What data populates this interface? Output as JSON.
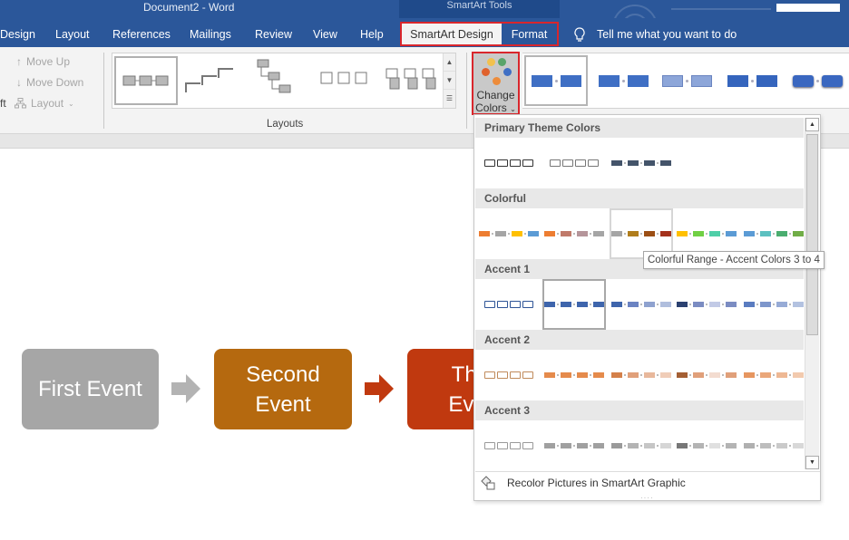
{
  "window": {
    "title": "Document2  -  Word",
    "contextual_group": "SmartArt Tools"
  },
  "tabs": [
    {
      "label": "Design"
    },
    {
      "label": "Layout"
    },
    {
      "label": "References"
    },
    {
      "label": "Mailings"
    },
    {
      "label": "Review"
    },
    {
      "label": "View"
    },
    {
      "label": "Help"
    }
  ],
  "contextual_tabs": {
    "smartart_design": "SmartArt Design",
    "format": "Format"
  },
  "tell_me": {
    "placeholder": "Tell me what you want to do",
    "icon": "lightbulb-icon"
  },
  "ribbon": {
    "create_graphic": {
      "move_up": "Move Up",
      "move_down": "Move Down",
      "layout": "Layout",
      "right_to_left_partial": "ft"
    },
    "layouts": {
      "group_label": "Layouts",
      "items": [
        "basic-process",
        "step-up-process",
        "descending-process",
        "picture-process",
        "detailed-process"
      ]
    },
    "change_colors": {
      "line1": "Change",
      "line2": "Colors",
      "dot_colors": [
        "#f2c14e",
        "#5aa469",
        "#e0622d",
        "#3f6fc4",
        "#ed8c3b"
      ]
    },
    "smartart_styles": {
      "items": [
        {
          "color": "#3f6fc4"
        },
        {
          "color": "#3f6fc4"
        },
        {
          "color": "#8da6d9"
        },
        {
          "color": "#3565bd"
        },
        {
          "color": "#3a67c0"
        }
      ]
    }
  },
  "color_menu": {
    "sections": [
      {
        "title": "Primary Theme Colors",
        "swatches": [
          {
            "outline": "#333333",
            "fills": [
              "none",
              "none",
              "none",
              "none"
            ]
          },
          {
            "outline": "#777777",
            "fills": [
              "none",
              "none",
              "none",
              "none"
            ]
          },
          {
            "outline": null,
            "fills": [
              "#44546a",
              "#44546a",
              "#44546a",
              "#44546a"
            ]
          }
        ]
      },
      {
        "title": "Colorful",
        "swatches": [
          {
            "fills": [
              "#ed7d31",
              "#a5a5a5",
              "#ffc000",
              "#5b9bd5"
            ]
          },
          {
            "fills": [
              "#ed7d31",
              "#c07a6a",
              "#b5959a",
              "#a5a5a5"
            ]
          },
          {
            "fills": [
              "#a5a5a5",
              "#b07d1c",
              "#9c4f14",
              "#a4321c"
            ]
          },
          {
            "fills": [
              "#ffc000",
              "#70d044",
              "#4fcfa8",
              "#5b9bd5"
            ]
          },
          {
            "fills": [
              "#5b9bd5",
              "#5cc0c0",
              "#4aad6f",
              "#70ad47"
            ]
          }
        ]
      },
      {
        "title": "Accent 1",
        "swatches": [
          {
            "outline": "#2f5597",
            "fills": [
              "none",
              "none",
              "none",
              "none"
            ]
          },
          {
            "fills": [
              "#3e65ac",
              "#3e65ac",
              "#3e65ac",
              "#3e65ac"
            ]
          },
          {
            "fills": [
              "#3e65ac",
              "#6b83c2",
              "#8fa2cf",
              "#b0bedd"
            ]
          },
          {
            "fills": [
              "#2b4170",
              "#7b8cc2",
              "#c2cae6",
              "#7b8cc2"
            ]
          },
          {
            "fills": [
              "#5a7cc0",
              "#7d96cb",
              "#97abd6",
              "#b3c2e0"
            ]
          }
        ]
      },
      {
        "title": "Accent 2",
        "swatches": [
          {
            "outline": "#c08a5a",
            "fills": [
              "none",
              "none",
              "none",
              "none"
            ]
          },
          {
            "fills": [
              "#e58b4c",
              "#e58b4c",
              "#e58b4c",
              "#e58b4c"
            ]
          },
          {
            "fills": [
              "#d4804a",
              "#e0a07a",
              "#e8b89c",
              "#f0cdb8"
            ]
          },
          {
            "fills": [
              "#a45f34",
              "#e0a07a",
              "#f3dcd0",
              "#e0a07a"
            ]
          },
          {
            "fills": [
              "#e69660",
              "#eaa77a",
              "#eeb894",
              "#f2caae"
            ]
          }
        ]
      },
      {
        "title": "Accent 3",
        "swatches": [
          {
            "outline": "#999999",
            "fills": [
              "none",
              "none",
              "none",
              "none"
            ]
          },
          {
            "fills": [
              "#a0a0a0",
              "#a0a0a0",
              "#a0a0a0",
              "#a0a0a0"
            ]
          },
          {
            "fills": [
              "#9a9a9a",
              "#b4b4b4",
              "#c6c6c6",
              "#d6d6d6"
            ]
          },
          {
            "fills": [
              "#777777",
              "#b4b4b4",
              "#e0e0e0",
              "#b4b4b4"
            ]
          },
          {
            "fills": [
              "#b0b0b0",
              "#bdbdbd",
              "#cacaca",
              "#d8d8d8"
            ]
          }
        ]
      }
    ],
    "selected": {
      "section": "Accent 1",
      "index": 1
    },
    "hovered": {
      "section": "Colorful",
      "index": 2
    },
    "tooltip": "Colorful Range - Accent Colors 3 to 4",
    "recolor_label": "Recolor Pictures in SmartArt Graphic"
  },
  "smartart": {
    "nodes": [
      {
        "label": "First Event",
        "color": "#a6a6a6"
      },
      {
        "label": "Second\nEvent",
        "color": "#b5690f"
      },
      {
        "label": "Third\nEvent",
        "color": "#c0390f"
      }
    ],
    "arrows": [
      {
        "color": "#b3b3b3"
      },
      {
        "color": "#c0390f"
      }
    ]
  }
}
